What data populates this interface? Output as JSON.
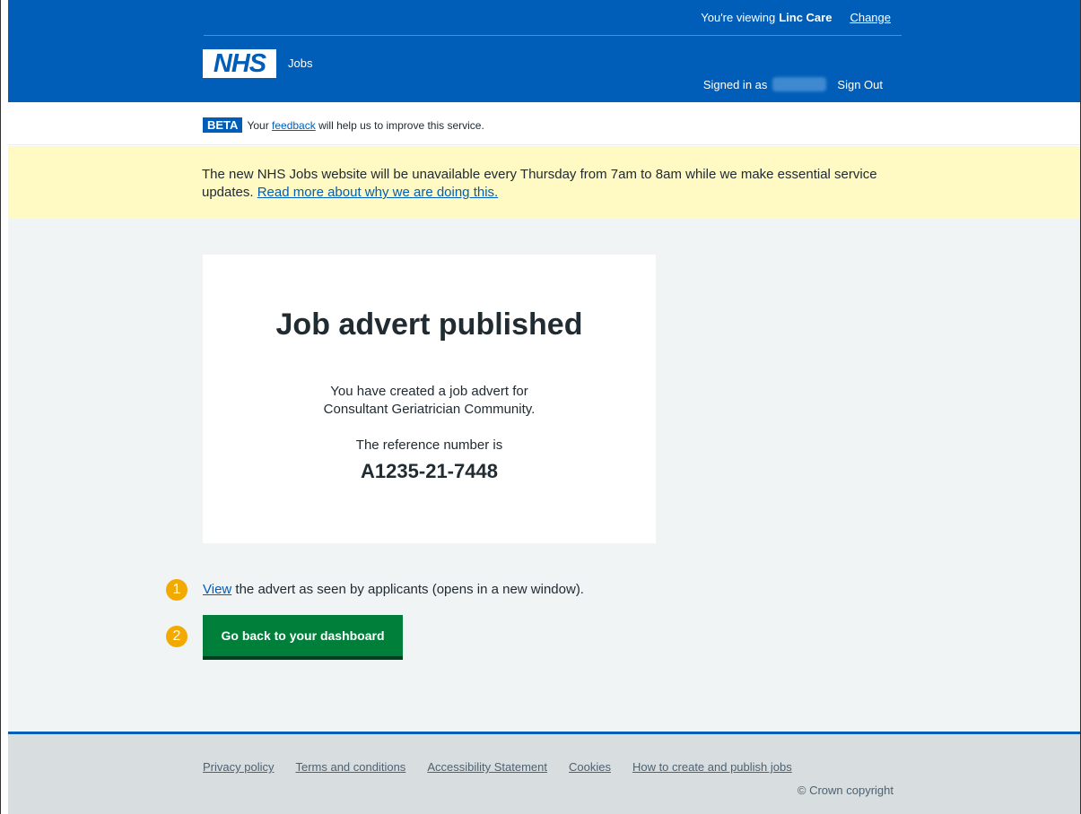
{
  "header": {
    "viewing_prefix": "You're viewing",
    "org_name": "Linc Care",
    "change_label": "Change",
    "logo_text": "NHS",
    "service_name": "Jobs",
    "signed_in_prefix": "Signed in as",
    "sign_out_label": "Sign Out"
  },
  "beta": {
    "tag": "BETA",
    "text_before": "Your",
    "feedback_link": "feedback",
    "text_after": "will help us to improve this service."
  },
  "notice": {
    "text": "The new NHS Jobs website will be unavailable every Thursday from 7am to 8am while we make essential service updates.",
    "link": "Read more about why we are doing this."
  },
  "panel": {
    "title": "Job advert published",
    "desc_line1": "You have created a job advert for",
    "desc_line2": "Consultant Geriatrician Community.",
    "ref_label": "The reference number is",
    "ref_number": "A1235-21-7448"
  },
  "actions": {
    "step1": "1",
    "view_link": "View",
    "view_text": "the advert as seen by applicants (opens in a new window).",
    "step2": "2",
    "dashboard_button": "Go back to your dashboard"
  },
  "footer": {
    "links": [
      "Privacy policy",
      "Terms and conditions",
      "Accessibility Statement",
      "Cookies",
      "How to create and publish jobs"
    ],
    "copyright": "© Crown copyright"
  },
  "colors": {
    "nhs_blue": "#005eb8",
    "button_green": "#007f3b",
    "notice_yellow": "#fff9c4",
    "step_badge": "#f2a900"
  }
}
